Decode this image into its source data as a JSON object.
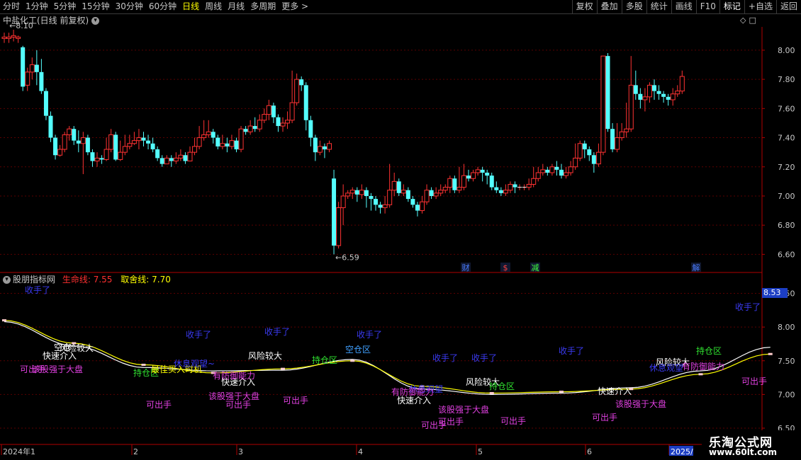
{
  "toolbar": {
    "periods": [
      "分时",
      "1分钟",
      "5分钟",
      "15分钟",
      "30分钟",
      "60分钟",
      "日线",
      "周线",
      "月线",
      "多周期",
      "更多 >"
    ],
    "active_period": "日线",
    "buttons": [
      "复权",
      "叠加",
      "多股",
      "统计",
      "画线",
      "F10",
      "+自选",
      "返回"
    ],
    "active_button": "标记"
  },
  "main_chart": {
    "title": "中盐化工(日线 前复权)",
    "high_label": "8.10",
    "low_label": "6.59",
    "markers": [
      {
        "text": "财",
        "color": "#4a7cff"
      },
      {
        "text": "$",
        "color": "#ff4040"
      },
      {
        "text": "减",
        "color": "#40ff40"
      },
      {
        "text": "解",
        "color": "#4a7cff"
      }
    ]
  },
  "indicator": {
    "name": "股朋指标网",
    "life_label": "生命线:",
    "life_value": "7.55",
    "decision_label": "取舍线:",
    "decision_value": "7.70",
    "badge": "8.53"
  },
  "time_axis": {
    "labels": [
      "2024年1",
      "2",
      "3",
      "4",
      "5",
      "6",
      "2025/"
    ]
  },
  "logo": {
    "line1": "乐淘公式网",
    "line2": "www.60lt.com"
  },
  "chart_data": [
    {
      "type": "candlestick",
      "title": "中盐化工(日线 前复权)",
      "ylim": [
        6.5,
        8.15
      ],
      "y_ticks": [
        "8.00",
        "7.80",
        "7.60",
        "7.40",
        "7.20",
        "7.00",
        "6.80",
        "6.60"
      ],
      "x_ticks": [
        "2024年1",
        "2",
        "3",
        "4",
        "5",
        "6",
        "2025/"
      ],
      "candles": [
        [
          8.08,
          8.09,
          8.12,
          8.05
        ],
        [
          8.08,
          8.09,
          8.12,
          8.05
        ],
        [
          8.09,
          8.1,
          8.14,
          8.06
        ],
        [
          8.08,
          8.09,
          8.1,
          8.05
        ],
        [
          8.02,
          7.75,
          8.03,
          7.72
        ],
        [
          7.76,
          7.85,
          7.88,
          7.72
        ],
        [
          7.85,
          7.9,
          7.95,
          7.8
        ],
        [
          7.9,
          7.85,
          8.0,
          7.76
        ],
        [
          7.85,
          7.72,
          7.94,
          7.7
        ],
        [
          7.72,
          7.55,
          7.74,
          7.52
        ],
        [
          7.55,
          7.4,
          7.58,
          7.37
        ],
        [
          7.4,
          7.28,
          7.42,
          7.25
        ],
        [
          7.28,
          7.32,
          7.35,
          7.27
        ],
        [
          7.32,
          7.42,
          7.44,
          7.3
        ],
        [
          7.42,
          7.46,
          7.48,
          7.38
        ],
        [
          7.46,
          7.38,
          7.48,
          7.35
        ],
        [
          7.38,
          7.36,
          7.45,
          7.3
        ],
        [
          7.36,
          7.4,
          7.44,
          7.15
        ],
        [
          7.4,
          7.3,
          7.42,
          7.28
        ],
        [
          7.3,
          7.24,
          7.32,
          7.2
        ],
        [
          7.24,
          7.26,
          7.3,
          7.2
        ],
        [
          7.26,
          7.25,
          7.28,
          7.22
        ],
        [
          7.25,
          7.32,
          7.4,
          7.24
        ],
        [
          7.32,
          7.42,
          7.46,
          7.3
        ],
        [
          7.42,
          7.25,
          7.44,
          7.24
        ],
        [
          7.25,
          7.3,
          7.38,
          7.24
        ],
        [
          7.3,
          7.34,
          7.42,
          7.28
        ],
        [
          7.34,
          7.36,
          7.42,
          7.32
        ],
        [
          7.36,
          7.38,
          7.44,
          7.35
        ],
        [
          7.38,
          7.4,
          7.46,
          7.32
        ],
        [
          7.4,
          7.38,
          7.44,
          7.34
        ],
        [
          7.38,
          7.36,
          7.42,
          7.32
        ],
        [
          7.36,
          7.32,
          7.4,
          7.3
        ],
        [
          7.32,
          7.26,
          7.34,
          7.24
        ],
        [
          7.26,
          7.22,
          7.28,
          7.2
        ],
        [
          7.22,
          7.26,
          7.28,
          7.22
        ],
        [
          7.26,
          7.24,
          7.28,
          7.2
        ],
        [
          7.24,
          7.26,
          7.3,
          7.22
        ],
        [
          7.26,
          7.28,
          7.32,
          7.24
        ],
        [
          7.28,
          7.24,
          7.3,
          7.22
        ],
        [
          7.24,
          7.3,
          7.34,
          7.24
        ],
        [
          7.3,
          7.34,
          7.4,
          7.28
        ],
        [
          7.34,
          7.4,
          7.48,
          7.32
        ],
        [
          7.4,
          7.42,
          7.52,
          7.38
        ],
        [
          7.42,
          7.44,
          7.52,
          7.4
        ],
        [
          7.44,
          7.4,
          7.46,
          7.36
        ],
        [
          7.4,
          7.34,
          7.42,
          7.32
        ],
        [
          7.34,
          7.36,
          7.42,
          7.32
        ],
        [
          7.36,
          7.34,
          7.4,
          7.3
        ],
        [
          7.34,
          7.38,
          7.42,
          7.32
        ],
        [
          7.38,
          7.32,
          7.4,
          7.3
        ],
        [
          7.32,
          7.46,
          7.48,
          7.3
        ],
        [
          7.46,
          7.44,
          7.48,
          7.42
        ],
        [
          7.44,
          7.48,
          7.52,
          7.42
        ],
        [
          7.48,
          7.46,
          7.54,
          7.44
        ],
        [
          7.46,
          7.52,
          7.56,
          7.44
        ],
        [
          7.52,
          7.56,
          7.6,
          7.5
        ],
        [
          7.56,
          7.62,
          7.66,
          7.52
        ],
        [
          7.62,
          7.54,
          7.64,
          7.5
        ],
        [
          7.54,
          7.48,
          7.56,
          7.44
        ],
        [
          7.48,
          7.5,
          7.54,
          7.44
        ],
        [
          7.5,
          7.52,
          7.58,
          7.46
        ],
        [
          7.52,
          7.64,
          7.86,
          7.5
        ],
        [
          7.64,
          7.8,
          7.84,
          7.62
        ],
        [
          7.8,
          7.76,
          7.82,
          7.72
        ],
        [
          7.76,
          7.52,
          7.78,
          7.45
        ],
        [
          7.52,
          7.4,
          7.55,
          7.34
        ],
        [
          7.4,
          7.3,
          7.42,
          7.24
        ],
        [
          7.3,
          7.34,
          7.38,
          7.28
        ],
        [
          7.34,
          7.32,
          7.36,
          7.26
        ],
        [
          7.32,
          7.36,
          7.38,
          7.3
        ],
        [
          7.12,
          6.66,
          7.18,
          6.6
        ],
        [
          6.66,
          6.92,
          6.96,
          6.64
        ],
        [
          6.92,
          7.0,
          7.08,
          6.8
        ],
        [
          7.0,
          7.02,
          7.04,
          6.98
        ],
        [
          7.02,
          7.04,
          7.06,
          6.98
        ],
        [
          7.04,
          7.01,
          7.06,
          6.96
        ],
        [
          7.01,
          7.04,
          7.08,
          6.98
        ],
        [
          7.04,
          7.0,
          7.06,
          6.92
        ],
        [
          7.0,
          6.98,
          7.02,
          6.9
        ],
        [
          6.98,
          6.94,
          7.0,
          6.9
        ],
        [
          6.94,
          6.92,
          6.96,
          6.88
        ],
        [
          6.92,
          6.94,
          7.0,
          6.88
        ],
        [
          6.94,
          7.04,
          7.22,
          6.92
        ],
        [
          7.04,
          7.1,
          7.16,
          7.0
        ],
        [
          7.1,
          7.02,
          7.12,
          7.0
        ],
        [
          7.02,
          7.04,
          7.08,
          7.0
        ],
        [
          7.04,
          6.98,
          7.06,
          6.96
        ],
        [
          6.98,
          6.94,
          7.0,
          6.92
        ],
        [
          6.94,
          6.9,
          6.96,
          6.86
        ],
        [
          6.9,
          6.96,
          7.0,
          6.88
        ],
        [
          6.96,
          7.04,
          7.08,
          6.94
        ],
        [
          7.04,
          7.0,
          7.06,
          6.98
        ],
        [
          7.0,
          7.02,
          7.06,
          6.98
        ],
        [
          7.02,
          7.04,
          7.08,
          7.0
        ],
        [
          7.04,
          7.06,
          7.08,
          7.02
        ],
        [
          7.06,
          7.12,
          7.14,
          7.02
        ],
        [
          7.12,
          7.04,
          7.14,
          7.02
        ],
        [
          7.04,
          7.06,
          7.2,
          7.02
        ],
        [
          7.06,
          7.14,
          7.22,
          7.04
        ],
        [
          7.14,
          7.12,
          7.18,
          7.1
        ],
        [
          7.12,
          7.16,
          7.18,
          7.1
        ],
        [
          7.16,
          7.18,
          7.2,
          7.14
        ],
        [
          7.18,
          7.16,
          7.2,
          7.1
        ],
        [
          7.16,
          7.14,
          7.18,
          7.08
        ],
        [
          7.14,
          7.06,
          7.16,
          7.04
        ],
        [
          7.06,
          7.04,
          7.1,
          7.02
        ],
        [
          7.04,
          7.02,
          7.06,
          7.0
        ],
        [
          7.02,
          7.04,
          7.08,
          7.0
        ],
        [
          7.04,
          7.08,
          7.1,
          7.02
        ],
        [
          7.08,
          7.06,
          7.1,
          7.02
        ],
        [
          7.06,
          7.06,
          7.08,
          7.04
        ],
        [
          7.06,
          7.06,
          7.08,
          7.04
        ],
        [
          7.06,
          7.08,
          7.12,
          7.04
        ],
        [
          7.08,
          7.12,
          7.2,
          7.06
        ],
        [
          7.12,
          7.16,
          7.2,
          7.1
        ],
        [
          7.16,
          7.18,
          7.22,
          7.14
        ],
        [
          7.18,
          7.16,
          7.2,
          7.14
        ],
        [
          7.16,
          7.2,
          7.22,
          7.14
        ],
        [
          7.2,
          7.18,
          7.24,
          7.14
        ],
        [
          7.18,
          7.14,
          7.22,
          7.12
        ],
        [
          7.14,
          7.16,
          7.2,
          7.12
        ],
        [
          7.16,
          7.2,
          7.24,
          7.14
        ],
        [
          7.2,
          7.26,
          7.36,
          7.18
        ],
        [
          7.26,
          7.36,
          7.38,
          7.24
        ],
        [
          7.36,
          7.32,
          7.38,
          7.26
        ],
        [
          7.32,
          7.28,
          7.34,
          7.24
        ],
        [
          7.28,
          7.22,
          7.3,
          7.16
        ],
        [
          7.22,
          7.3,
          7.36,
          7.2
        ],
        [
          7.3,
          7.96,
          7.96,
          7.28
        ],
        [
          7.96,
          7.46,
          7.98,
          7.44
        ],
        [
          7.46,
          7.32,
          7.5,
          7.3
        ],
        [
          7.32,
          7.4,
          7.5,
          7.3
        ],
        [
          7.4,
          7.44,
          7.5,
          7.38
        ],
        [
          7.44,
          7.46,
          7.64,
          7.4
        ],
        [
          7.46,
          7.76,
          7.96,
          7.44
        ],
        [
          7.76,
          7.7,
          7.86,
          7.66
        ],
        [
          7.7,
          7.66,
          7.74,
          7.6
        ],
        [
          7.66,
          7.68,
          7.74,
          7.58
        ],
        [
          7.68,
          7.76,
          7.78,
          7.64
        ],
        [
          7.76,
          7.72,
          7.8,
          7.66
        ],
        [
          7.72,
          7.7,
          7.76,
          7.66
        ],
        [
          7.7,
          7.68,
          7.72,
          7.64
        ],
        [
          7.68,
          7.66,
          7.7,
          7.62
        ],
        [
          7.66,
          7.7,
          7.74,
          7.62
        ],
        [
          7.7,
          7.72,
          7.76,
          7.68
        ],
        [
          7.72,
          7.82,
          7.86,
          7.7
        ]
      ]
    },
    {
      "type": "line",
      "title": "股朋指标网",
      "ylim": [
        6.5,
        8.6
      ],
      "y_ticks": [
        "8.50",
        "8.00",
        "7.50",
        "7.00",
        "6.50"
      ],
      "series": [
        {
          "name": "生命线",
          "color": "#ffffff",
          "x": [
            0,
            15,
            30,
            45,
            60,
            75,
            90,
            105,
            120,
            135,
            150,
            165
          ],
          "values": [
            8.08,
            7.72,
            7.4,
            7.35,
            7.36,
            7.52,
            7.08,
            7.0,
            7.02,
            7.1,
            7.35,
            7.7
          ]
        },
        {
          "name": "取舍线",
          "color": "#ffff00",
          "x": [
            0,
            15,
            30,
            45,
            60,
            75,
            90,
            105,
            120,
            135,
            150,
            165
          ],
          "values": [
            8.1,
            7.76,
            7.44,
            7.32,
            7.38,
            7.5,
            7.12,
            7.02,
            7.04,
            7.08,
            7.3,
            7.6
          ]
        }
      ],
      "annotations": [
        {
          "text": "收手了",
          "color": "#3a3af0"
        },
        {
          "text": "收手了",
          "color": "#3a3af0"
        },
        {
          "text": "收手了",
          "color": "#3a3af0"
        },
        {
          "text": "收手了",
          "color": "#3a3af0"
        },
        {
          "text": "收手了",
          "color": "#3a3af0"
        },
        {
          "text": "收手了",
          "color": "#3a3af0"
        },
        {
          "text": "收手了",
          "color": "#3a3af0"
        },
        {
          "text": "收手了",
          "color": "#3a3af0"
        },
        {
          "text": "风险较大",
          "color": "#ffffff"
        },
        {
          "text": "风险较大",
          "color": "#ffffff"
        },
        {
          "text": "风险较大",
          "color": "#ffffff"
        },
        {
          "text": "风险较大",
          "color": "#ffffff"
        },
        {
          "text": "快速介入",
          "color": "#ffffff"
        },
        {
          "text": "快速介入",
          "color": "#ffffff"
        },
        {
          "text": "快速介入",
          "color": "#ffffff"
        },
        {
          "text": "快速介入",
          "color": "#ffffff"
        },
        {
          "text": "可出手",
          "color": "#e040e0"
        },
        {
          "text": "可出手",
          "color": "#e040e0"
        },
        {
          "text": "可出手",
          "color": "#e040e0"
        },
        {
          "text": "可出手",
          "color": "#e040e0"
        },
        {
          "text": "可出手",
          "color": "#e040e0"
        },
        {
          "text": "可出手",
          "color": "#e040e0"
        },
        {
          "text": "可出手",
          "color": "#e040e0"
        },
        {
          "text": "可出手",
          "color": "#e040e0"
        },
        {
          "text": "可出手",
          "color": "#e040e0"
        },
        {
          "text": "该股强于大盘",
          "color": "#e040e0"
        },
        {
          "text": "该股强于大盘",
          "color": "#e040e0"
        },
        {
          "text": "该股强于大盘",
          "color": "#e040e0"
        },
        {
          "text": "该股强于大盘",
          "color": "#e040e0"
        },
        {
          "text": "持仓区",
          "color": "#30e030"
        },
        {
          "text": "持仓区",
          "color": "#30e030"
        },
        {
          "text": "持仓区",
          "color": "#30e030"
        },
        {
          "text": "持仓区",
          "color": "#30e030"
        },
        {
          "text": "空仓区",
          "color": "#40a0ff"
        },
        {
          "text": "最佳买入时机",
          "color": "#ffff00"
        },
        {
          "text": "休息观望~",
          "color": "#3a3af0"
        },
        {
          "text": "休息观望",
          "color": "#3a3af0"
        },
        {
          "text": "休息观望",
          "color": "#3a3af0"
        },
        {
          "text": "有防御能力",
          "color": "#e040e0"
        },
        {
          "text": "有防御能力",
          "color": "#e040e0"
        },
        {
          "text": "有防御能力",
          "color": "#e040e0"
        },
        {
          "text": "空仓",
          "color": "#ffffff"
        }
      ]
    }
  ]
}
